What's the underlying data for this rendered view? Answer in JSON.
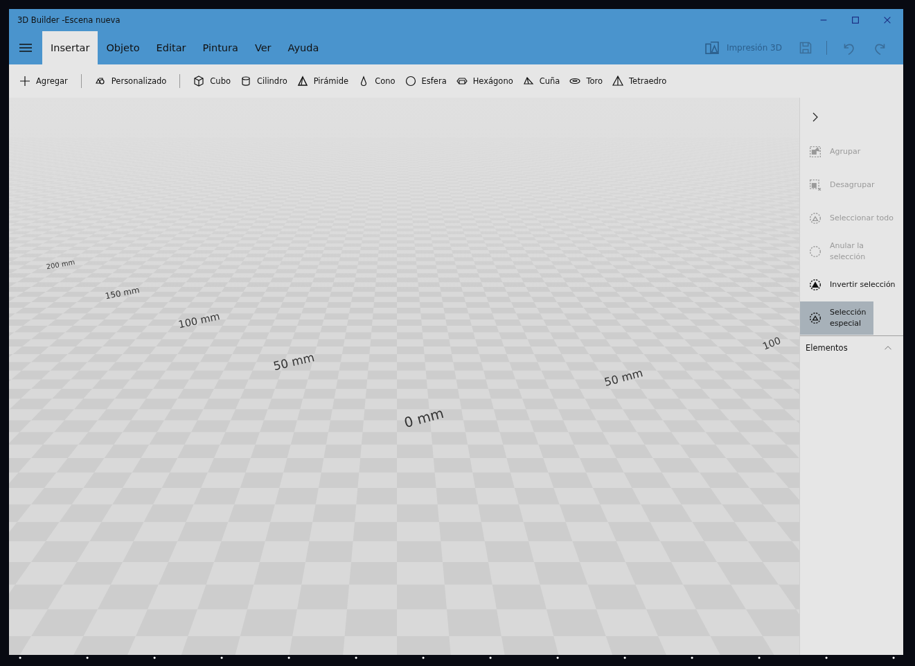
{
  "window": {
    "title": "3D Builder -Escena nueva"
  },
  "tabs": [
    {
      "label": "Insertar",
      "selected": true
    },
    {
      "label": "Objeto",
      "selected": false
    },
    {
      "label": "Editar",
      "selected": false
    },
    {
      "label": "Pintura",
      "selected": false
    },
    {
      "label": "Ver",
      "selected": false
    },
    {
      "label": "Ayuda",
      "selected": false
    }
  ],
  "print_button": {
    "label": "Impresión 3D",
    "disabled": true
  },
  "toolbar": [
    {
      "kind": "add",
      "label": "Agregar"
    },
    {
      "kind": "custom",
      "label": "Personalizado"
    },
    {
      "kind": "shape",
      "label": "Cubo"
    },
    {
      "kind": "shape",
      "label": "Cilindro"
    },
    {
      "kind": "shape",
      "label": "Pirámide"
    },
    {
      "kind": "shape",
      "label": "Cono"
    },
    {
      "kind": "shape",
      "label": "Esfera"
    },
    {
      "kind": "shape",
      "label": "Hexágono"
    },
    {
      "kind": "shape",
      "label": "Cuña"
    },
    {
      "kind": "shape",
      "label": "Toro"
    },
    {
      "kind": "shape",
      "label": "Tetraedro"
    }
  ],
  "scene_labels": [
    "200 mm",
    "150 mm",
    "100 mm",
    "50 mm",
    "0 mm",
    "50 mm",
    "100"
  ],
  "side_panel": {
    "actions": [
      {
        "label": "Agrupar",
        "disabled": true,
        "selected": false
      },
      {
        "label": "Desagrupar",
        "disabled": true,
        "selected": false
      },
      {
        "label": "Seleccionar todo",
        "disabled": true,
        "selected": false
      },
      {
        "label": "Anular la selección",
        "disabled": true,
        "selected": false
      },
      {
        "label": "Invertir selección",
        "disabled": false,
        "selected": false
      },
      {
        "label": "Selección especial",
        "disabled": false,
        "selected": true
      }
    ],
    "section": {
      "label": "Elementos",
      "expanded": true
    }
  }
}
